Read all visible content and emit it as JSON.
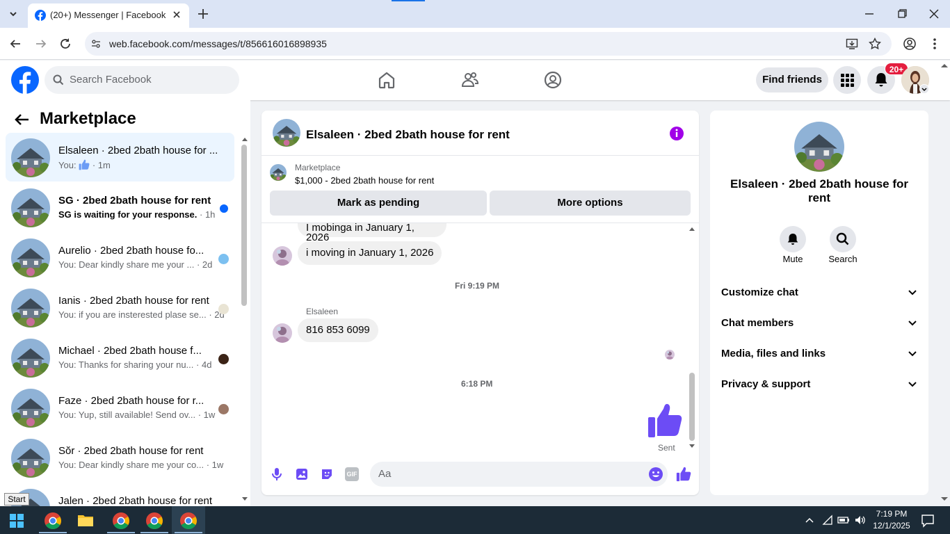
{
  "browser": {
    "tab_title": "(20+) Messenger | Facebook",
    "url": "web.facebook.com/messages/t/856616016898935"
  },
  "header": {
    "search_placeholder": "Search Facebook",
    "find_friends": "Find friends",
    "notif_badge": "20+"
  },
  "left": {
    "title": "Marketplace",
    "conversations": [
      {
        "name": "Elsaleen · 2bed 2bath house for ...",
        "preview_prefix": "You:",
        "preview": "· 1m",
        "selected": true
      },
      {
        "name": "SG · 2bed 2bath house for rent",
        "preview": "SG is waiting for your response.",
        "time": "· 1h",
        "unread": true
      },
      {
        "name": "Aurelio · 2bed 2bath house fo...",
        "preview": "You: Dear kindly share me your ...",
        "time": "· 2d"
      },
      {
        "name": "Ianis · 2bed 2bath house for rent",
        "preview": "You: if you are insterested plase se...",
        "time": "· 2d"
      },
      {
        "name": "Michael · 2bed 2bath house f...",
        "preview": "You: Thanks for sharing your nu...",
        "time": "· 4d"
      },
      {
        "name": "Faze · 2bed 2bath house for r...",
        "preview": "You: Yup, still available! Send ov...",
        "time": "· 1w"
      },
      {
        "name": "Sŏr · 2bed 2bath house for rent",
        "preview": "You: Dear kindly share me your co...",
        "time": "· 1w"
      },
      {
        "name": "Jalen · 2bed 2bath house for rent",
        "preview": "",
        "time": ""
      }
    ]
  },
  "chat": {
    "title": "Elsaleen · 2bed 2bath house for rent",
    "marketplace_label": "Marketplace",
    "listing": "$1,000 - 2bed 2bath house for rent",
    "mark_pending": "Mark as pending",
    "more_options": "More options",
    "messages": [
      {
        "text": "I mobinga in January 1, 2026"
      },
      {
        "text": "i moving in January 1, 2026"
      },
      {
        "timestamp": "Fri 9:19 PM"
      },
      {
        "sender": "Elsaleen",
        "text": "816 853 6099"
      },
      {
        "timestamp": "6:18 PM"
      }
    ],
    "sent_label": "Sent",
    "composer_placeholder": "Aa",
    "gif_label": "GIF"
  },
  "right": {
    "name": "Elsaleen · 2bed 2bath house for rent",
    "mute": "Mute",
    "search": "Search",
    "sections": [
      "Customize chat",
      "Chat members",
      "Media, files and links",
      "Privacy & support"
    ]
  },
  "taskbar": {
    "start_tooltip": "Start",
    "time": "7:19 PM",
    "date": "12/1/2025"
  },
  "colors": {
    "fb_blue": "#0866ff",
    "messenger_purple": "#6c4cf5",
    "info_purple": "#a100e8"
  }
}
